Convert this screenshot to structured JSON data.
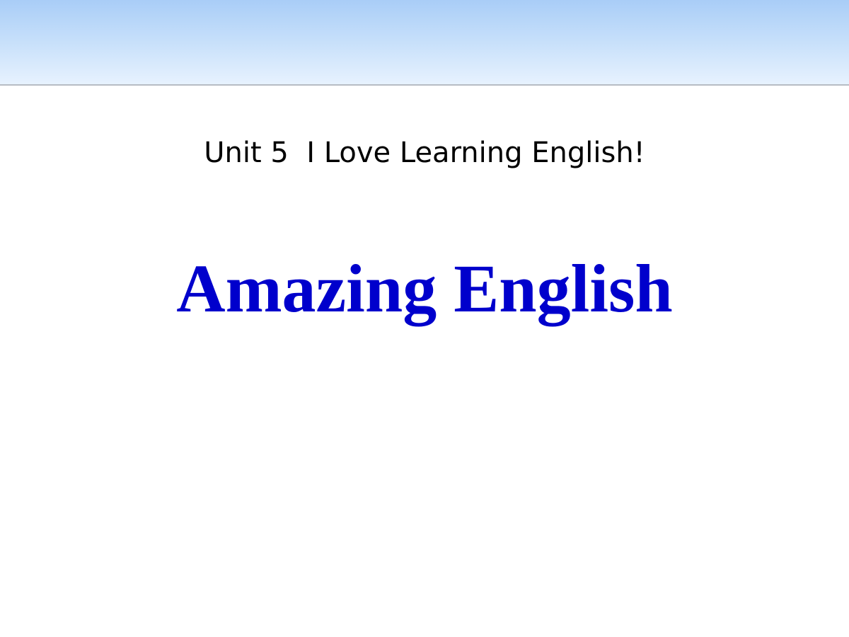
{
  "slide": {
    "subtitle": "Unit 5  I Love Learning English!",
    "title": "Amazing English"
  },
  "colors": {
    "title": "#0000cc",
    "subtitle": "#000000",
    "header_band_top": "#a9cdf7",
    "header_band_bottom": "#e7f2fe",
    "header_rule": "#b7bcc4",
    "background": "#ffffff"
  }
}
